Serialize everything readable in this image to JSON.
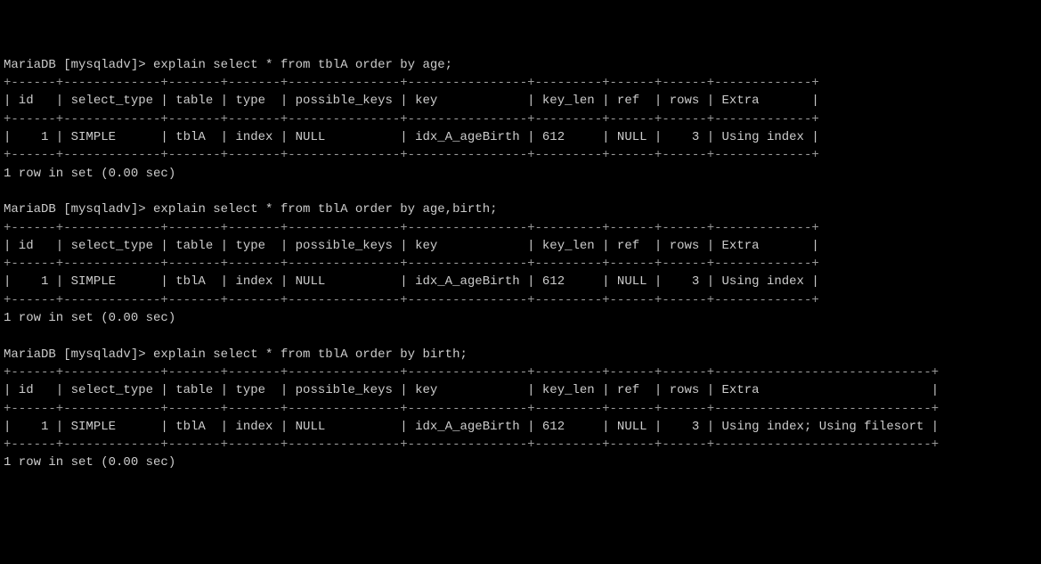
{
  "blocks": [
    {
      "prompt": "MariaDB [mysqladv]> ",
      "command": "explain select * from tblA order by age;",
      "divider_top": "+------+-------------+-------+-------+---------------+----------------+---------+------+------+-------------+",
      "header_row": "| id   | select_type | table | type  | possible_keys | key            | key_len | ref  | rows | Extra       |",
      "divider_mid": "+------+-------------+-------+-------+---------------+----------------+---------+------+------+-------------+",
      "data_row": "|    1 | SIMPLE      | tblA  | index | NULL          | idx_A_ageBirth | 612     | NULL |    3 | Using index |",
      "divider_bot": "+------+-------------+-------+-------+---------------+----------------+---------+------+------+-------------+",
      "footer": "1 row in set (0.00 sec)"
    },
    {
      "prompt": "MariaDB [mysqladv]> ",
      "command": "explain select * from tblA order by age,birth;",
      "divider_top": "+------+-------------+-------+-------+---------------+----------------+---------+------+------+-------------+",
      "header_row": "| id   | select_type | table | type  | possible_keys | key            | key_len | ref  | rows | Extra       |",
      "divider_mid": "+------+-------------+-------+-------+---------------+----------------+---------+------+------+-------------+",
      "data_row": "|    1 | SIMPLE      | tblA  | index | NULL          | idx_A_ageBirth | 612     | NULL |    3 | Using index |",
      "divider_bot": "+------+-------------+-------+-------+---------------+----------------+---------+------+------+-------------+",
      "footer": "1 row in set (0.00 sec)"
    },
    {
      "prompt": "MariaDB [mysqladv]> ",
      "command": "explain select * from tblA order by birth;",
      "divider_top": "+------+-------------+-------+-------+---------------+----------------+---------+------+------+-----------------------------+",
      "header_row": "| id   | select_type | table | type  | possible_keys | key            | key_len | ref  | rows | Extra                       |",
      "divider_mid": "+------+-------------+-------+-------+---------------+----------------+---------+------+------+-----------------------------+",
      "data_row": "|    1 | SIMPLE      | tblA  | index | NULL          | idx_A_ageBirth | 612     | NULL |    3 | Using index; Using filesort |",
      "divider_bot": "+------+-------------+-------+-------+---------------+----------------+---------+------+------+-----------------------------+",
      "footer": "1 row in set (0.00 sec)"
    }
  ],
  "chart_data": {
    "type": "table",
    "title": "MariaDB EXPLAIN output for three ORDER BY queries on tblA",
    "columns": [
      "id",
      "select_type",
      "table",
      "type",
      "possible_keys",
      "key",
      "key_len",
      "ref",
      "rows",
      "Extra"
    ],
    "queries": [
      {
        "sql": "explain select * from tblA order by age;",
        "row": {
          "id": 1,
          "select_type": "SIMPLE",
          "table": "tblA",
          "type": "index",
          "possible_keys": "NULL",
          "key": "idx_A_ageBirth",
          "key_len": 612,
          "ref": "NULL",
          "rows": 3,
          "Extra": "Using index"
        }
      },
      {
        "sql": "explain select * from tblA order by age,birth;",
        "row": {
          "id": 1,
          "select_type": "SIMPLE",
          "table": "tblA",
          "type": "index",
          "possible_keys": "NULL",
          "key": "idx_A_ageBirth",
          "key_len": 612,
          "ref": "NULL",
          "rows": 3,
          "Extra": "Using index"
        }
      },
      {
        "sql": "explain select * from tblA order by birth;",
        "row": {
          "id": 1,
          "select_type": "SIMPLE",
          "table": "tblA",
          "type": "index",
          "possible_keys": "NULL",
          "key": "idx_A_ageBirth",
          "key_len": 612,
          "ref": "NULL",
          "rows": 3,
          "Extra": "Using index; Using filesort"
        }
      }
    ]
  }
}
